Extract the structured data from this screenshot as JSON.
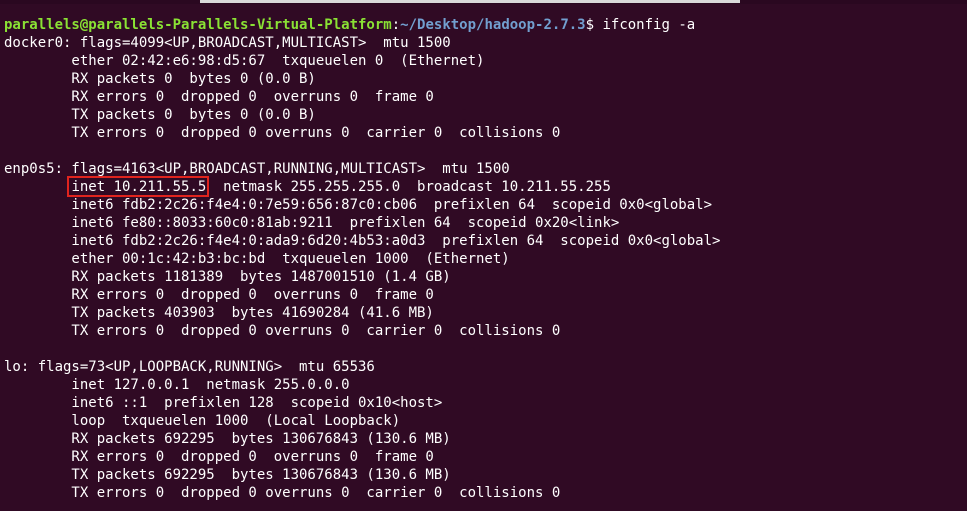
{
  "prompt": {
    "user_host": "parallels@parallels-Parallels-Virtual-Platform",
    "separator": ":",
    "path": "~/Desktop/hadoop-2.7.3",
    "symbol": "$ ",
    "command": "ifconfig -a"
  },
  "docker0": {
    "header": "docker0: flags=4099<UP,BROADCAST,MULTICAST>  mtu 1500",
    "ether": "        ether 02:42:e6:98:d5:67  txqueuelen 0  (Ethernet)",
    "rx_packets": "        RX packets 0  bytes 0 (0.0 B)",
    "rx_errors": "        RX errors 0  dropped 0  overruns 0  frame 0",
    "tx_packets": "        TX packets 0  bytes 0 (0.0 B)",
    "tx_errors": "        TX errors 0  dropped 0 overruns 0  carrier 0  collisions 0"
  },
  "enp0s5": {
    "header": "enp0s5: flags=4163<UP,BROADCAST,RUNNING,MULTICAST>  mtu 1500",
    "inet_indent": "        ",
    "inet_highlight": "inet 10.211.55.5",
    "inet_rest": "  netmask 255.255.255.0  broadcast 10.211.55.255",
    "inet6_1": "        inet6 fdb2:2c26:f4e4:0:7e59:656:87c0:cb06  prefixlen 64  scopeid 0x0<global>",
    "inet6_2": "        inet6 fe80::8033:60c0:81ab:9211  prefixlen 64  scopeid 0x20<link>",
    "inet6_3": "        inet6 fdb2:2c26:f4e4:0:ada9:6d20:4b53:a0d3  prefixlen 64  scopeid 0x0<global>",
    "ether": "        ether 00:1c:42:b3:bc:bd  txqueuelen 1000  (Ethernet)",
    "rx_packets": "        RX packets 1181389  bytes 1487001510 (1.4 GB)",
    "rx_errors": "        RX errors 0  dropped 0  overruns 0  frame 0",
    "tx_packets": "        TX packets 403903  bytes 41690284 (41.6 MB)",
    "tx_errors": "        TX errors 0  dropped 0 overruns 0  carrier 0  collisions 0"
  },
  "lo": {
    "header": "lo: flags=73<UP,LOOPBACK,RUNNING>  mtu 65536",
    "inet": "        inet 127.0.0.1  netmask 255.0.0.0",
    "inet6": "        inet6 ::1  prefixlen 128  scopeid 0x10<host>",
    "loop": "        loop  txqueuelen 1000  (Local Loopback)",
    "rx_packets": "        RX packets 692295  bytes 130676843 (130.6 MB)",
    "rx_errors": "        RX errors 0  dropped 0  overruns 0  frame 0",
    "tx_packets": "        TX packets 692295  bytes 130676843 (130.6 MB)",
    "tx_errors": "        TX errors 0  dropped 0 overruns 0  carrier 0  collisions 0"
  },
  "colors": {
    "background": "#300a24",
    "text": "#ffffff",
    "user_host": "#8ae234",
    "path": "#729fcf",
    "highlight_box": "#e0241e"
  }
}
